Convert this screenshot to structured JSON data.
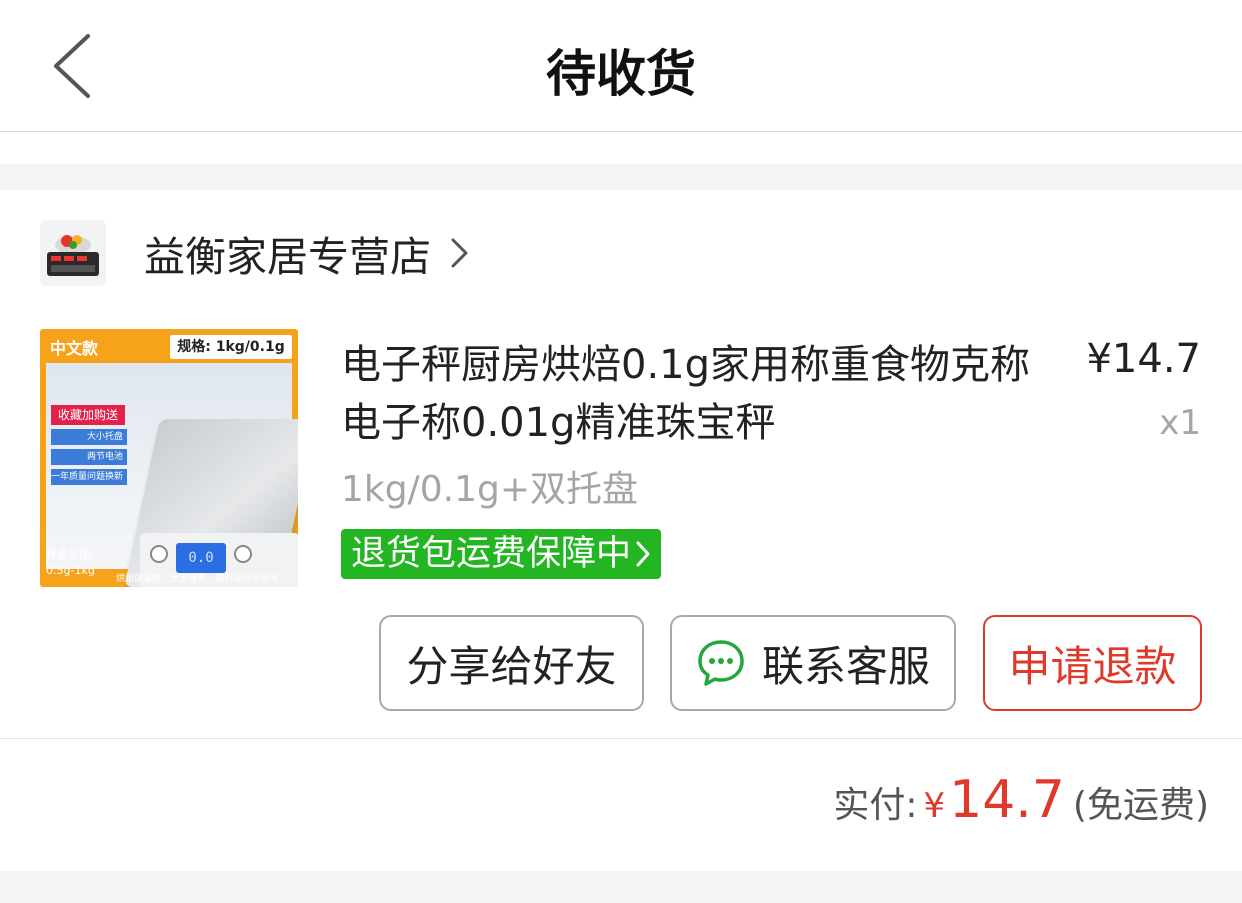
{
  "header": {
    "title": "待收货",
    "back_icon": "chevron-left-icon"
  },
  "shop": {
    "name": "益衡家居专营店",
    "logo_icon": "shop-logo",
    "chevron_icon": "chevron-right-icon"
  },
  "product": {
    "thumbnail": {
      "tag_left": "中文款",
      "tag_right": "规格: 1kg/0.1g",
      "badge": "收藏加购送",
      "features": [
        "大小托盘",
        "两节电池",
        "一年质量问题换新"
      ],
      "lcd": "0.0",
      "range_label": "称重范围:",
      "range_value": "0.5g-1kg",
      "uses": "烘焙做蛋糕、宝宝辅食、调料及日常使用"
    },
    "title": "电子秤厨房烘焙0.1g家用称重食物克称电子称0.01g精准珠宝秤",
    "price": "¥14.7",
    "quantity": "x1",
    "spec": "1kg/0.1g+双托盘",
    "guarantee": "退货包运费保障中"
  },
  "actions": {
    "share": "分享给好友",
    "service": "联系客服",
    "service_icon": "chat-bubble-icon",
    "refund": "申请退款"
  },
  "summary": {
    "label": "实付:",
    "currency": "¥",
    "amount": "14.7",
    "shipping": "(免运费)"
  },
  "colors": {
    "accent_red": "#e0392c",
    "guarantee_green": "#24b523",
    "muted_text": "#a5a5a5",
    "gap_gray": "#f4f4f4"
  }
}
